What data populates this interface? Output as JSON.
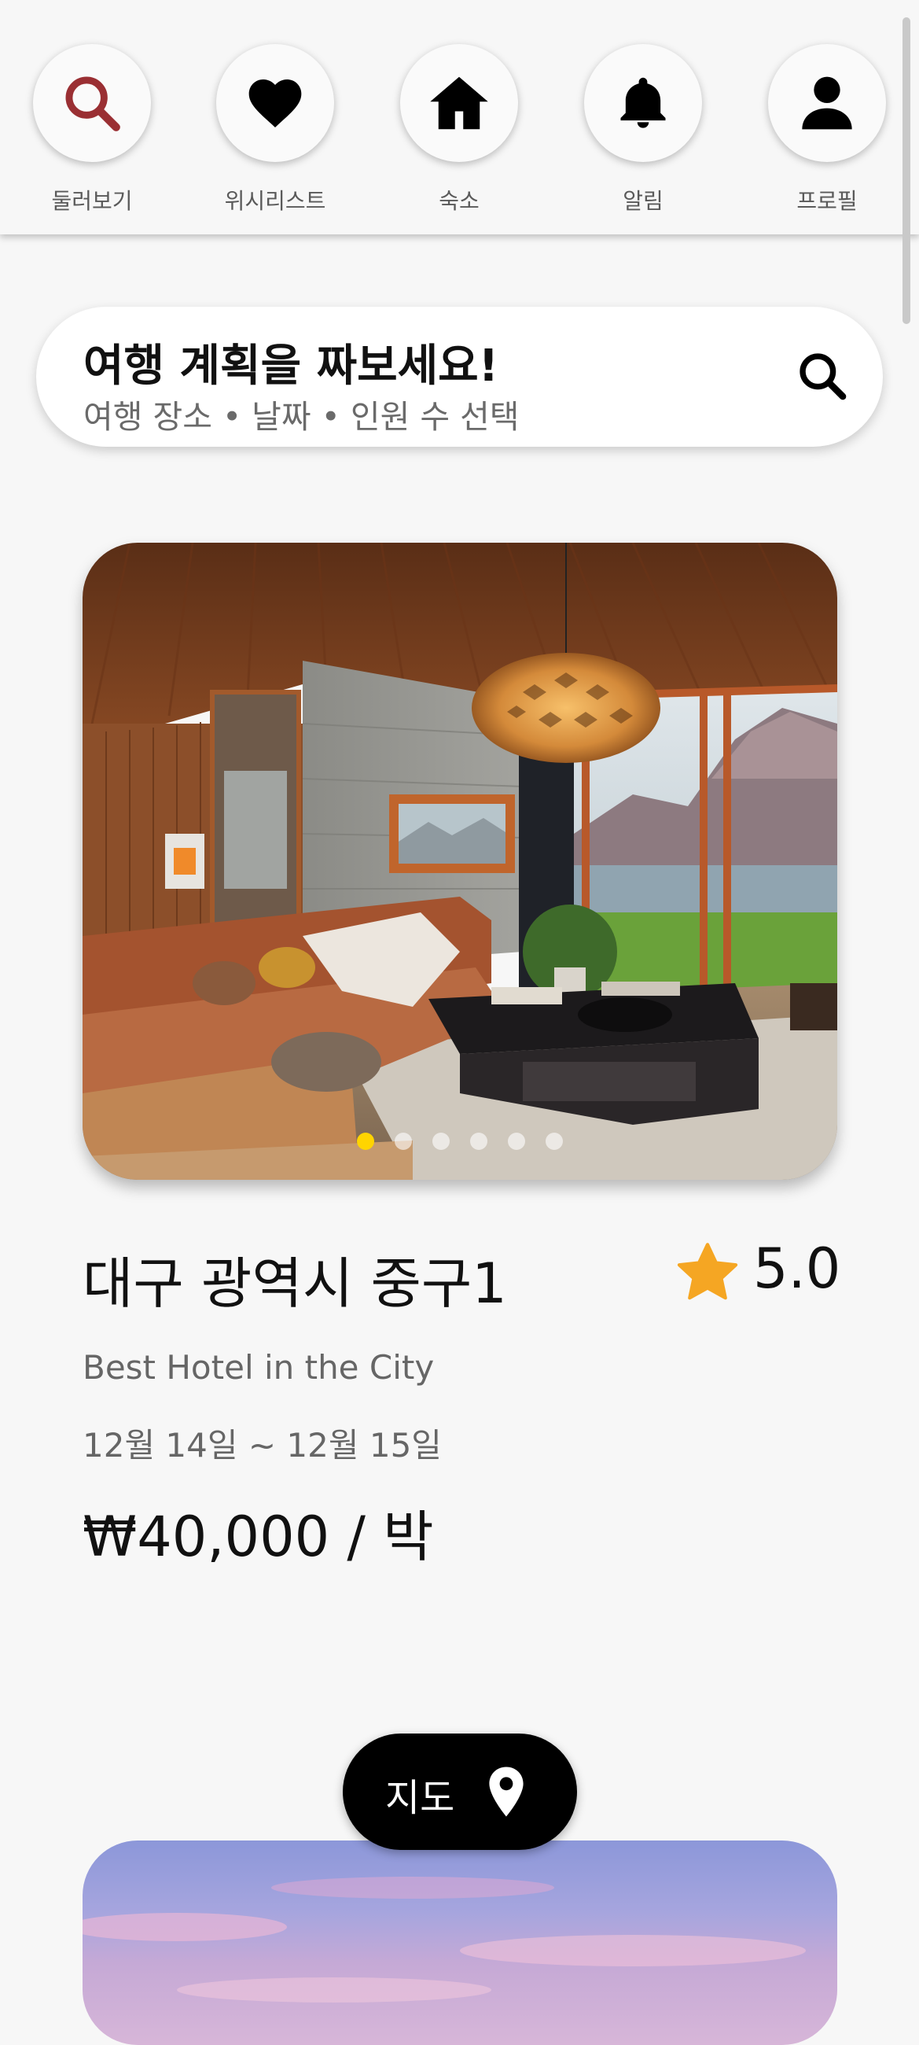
{
  "nav": {
    "items": [
      {
        "label": "둘러보기",
        "icon": "search-icon",
        "active": true
      },
      {
        "label": "위시리스트",
        "icon": "heart-icon"
      },
      {
        "label": "숙소",
        "icon": "home-icon"
      },
      {
        "label": "알림",
        "icon": "bell-icon"
      },
      {
        "label": "프로필",
        "icon": "person-icon"
      }
    ],
    "active_color": "#9a2f33"
  },
  "search": {
    "title": "여행 계획을 짜보세요!",
    "subtitle": "여행 장소 • 날짜 • 인원 수 선택",
    "icon": "search-icon"
  },
  "listing": {
    "title": "대구 광역시 중구1",
    "rating": "5.0",
    "rating_icon": "star-icon",
    "description": "Best Hotel in the City",
    "dates": "12월 14일 ~ 12월 15일",
    "price": "₩40,000 / 박",
    "image_count": 6,
    "active_image": 1,
    "star_color": "#f5a623",
    "dot_active_color": "#ffd400"
  },
  "map_button": {
    "label": "지도",
    "icon": "map-pin-icon"
  }
}
